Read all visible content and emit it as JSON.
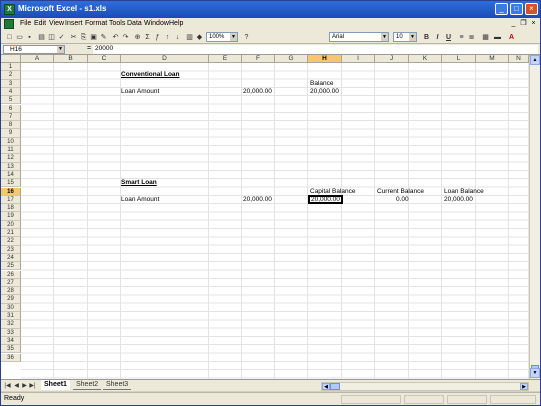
{
  "window": {
    "title": "Microsoft Excel - s1.xls",
    "app_icon_glyph": "X"
  },
  "menu": {
    "items": [
      "File",
      "Edit",
      "View",
      "Insert",
      "Format",
      "Tools",
      "Data",
      "Window",
      "Help"
    ]
  },
  "toolbar": {
    "zoom": "100%",
    "font": "Arial",
    "font_size": "10",
    "bold": "B",
    "italic": "I",
    "underline": "U"
  },
  "formula_bar": {
    "name_box": "H16",
    "fx": "=",
    "value": "20000"
  },
  "columns": [
    "A",
    "B",
    "C",
    "D",
    "E",
    "F",
    "G",
    "H",
    "I",
    "J",
    "K",
    "L",
    "M",
    "N"
  ],
  "selected_column": "H",
  "rows": [
    "1",
    "2",
    "3",
    "4",
    "5",
    "6",
    "7",
    "8",
    "9",
    "10",
    "11",
    "12",
    "13",
    "14",
    "15",
    "16",
    "17",
    "18",
    "19",
    "20",
    "21",
    "22",
    "23",
    "24",
    "25",
    "26",
    "27",
    "28",
    "29",
    "30",
    "31",
    "32",
    "33",
    "34",
    "35",
    "36"
  ],
  "selected_row": "16",
  "cells": {
    "d2": "Conventional Loan",
    "h3": "Balance",
    "d4": "Loan Amount",
    "f4": "20,000.00",
    "h4": "20,000.00",
    "d14": "Smart Loan",
    "h15": "Capital Balance",
    "j15": "Current Balance",
    "l15": "Loan Balance",
    "d16": "Loan Amount",
    "f16": "20,000.00",
    "h16": "20,000.00",
    "j16": "0.00",
    "l16": "20,000.00"
  },
  "sheet_tabs": [
    "Sheet1",
    "Sheet2",
    "Sheet3"
  ],
  "active_sheet": "Sheet1",
  "status": "Ready",
  "colors": {
    "title_bar": "#1a4bb8",
    "selected_header": "#f5c96b",
    "chrome": "#ece9d8"
  }
}
